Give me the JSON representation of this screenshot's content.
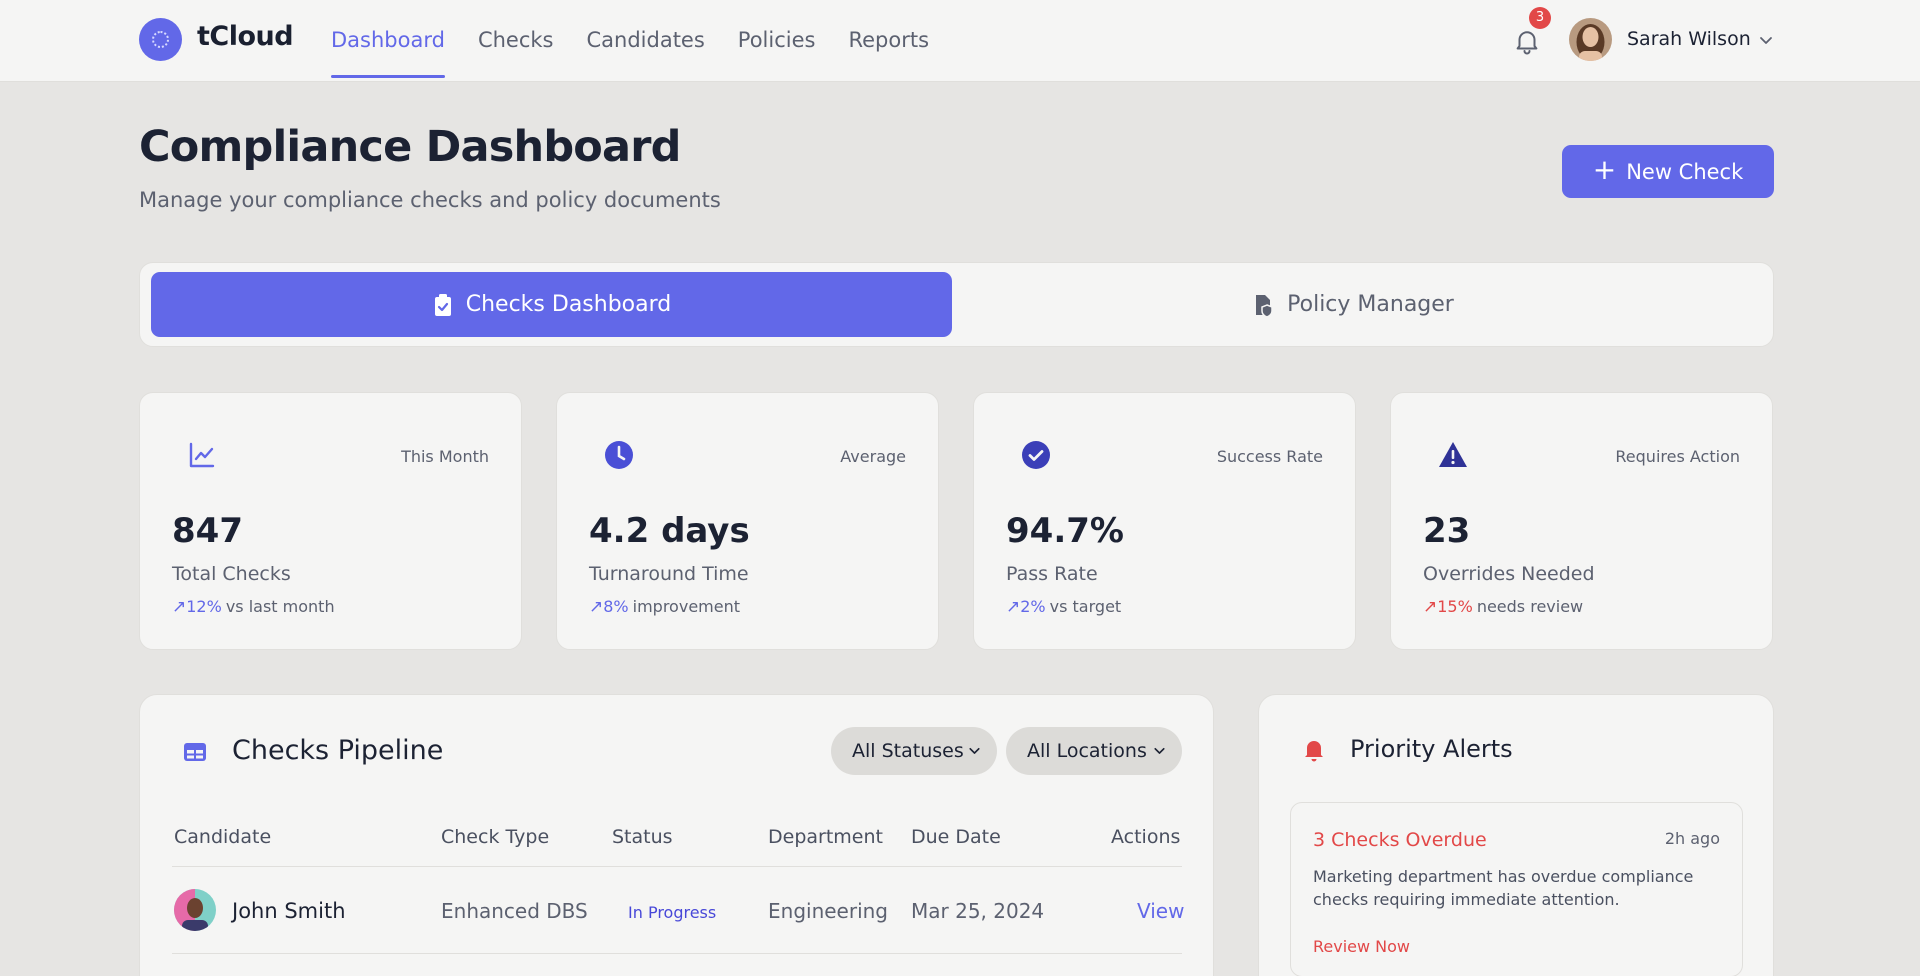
{
  "brand": {
    "name": "tCloud"
  },
  "nav": {
    "items": [
      {
        "label": "Dashboard",
        "active": true
      },
      {
        "label": "Checks"
      },
      {
        "label": "Candidates"
      },
      {
        "label": "Policies"
      },
      {
        "label": "Reports"
      }
    ]
  },
  "user": {
    "name": "Sarah Wilson",
    "notification_count": "3"
  },
  "header": {
    "title": "Compliance Dashboard",
    "subtitle": "Manage your compliance checks and policy documents",
    "new_check_label": "New Check"
  },
  "tabs": [
    {
      "label": "Checks Dashboard",
      "active": true,
      "icon": "clipboard-check-icon"
    },
    {
      "label": "Policy Manager",
      "icon": "file-shield-icon"
    }
  ],
  "stats": [
    {
      "tag": "This Month",
      "value": "847",
      "label": "Total Checks",
      "trend_pct": "12%",
      "trend_text": "vs last month",
      "icon": "chart-line-icon"
    },
    {
      "tag": "Average",
      "value": "4.2 days",
      "label": "Turnaround Time",
      "trend_pct": "8%",
      "trend_text": "improvement",
      "icon": "clock-icon"
    },
    {
      "tag": "Success Rate",
      "value": "94.7%",
      "label": "Pass Rate",
      "trend_pct": "2%",
      "trend_text": "vs target",
      "icon": "check-circle-icon"
    },
    {
      "tag": "Requires Action",
      "value": "23",
      "label": "Overrides Needed",
      "trend_pct": "15%",
      "trend_text": "needs review",
      "icon": "warning-icon"
    }
  ],
  "pipeline": {
    "title": "Checks Pipeline",
    "filters": {
      "status": "All Statuses",
      "location": "All Locations"
    },
    "columns": [
      "Candidate",
      "Check Type",
      "Status",
      "Department",
      "Due Date",
      "Actions"
    ],
    "rows": [
      {
        "candidate": "John Smith",
        "check_type": "Enhanced DBS",
        "status": "In Progress",
        "department": "Engineering",
        "due_date": "Mar 25, 2024",
        "action": "View"
      }
    ]
  },
  "alerts": {
    "title": "Priority Alerts",
    "items": [
      {
        "title": "3 Checks Overdue",
        "time": "2h ago",
        "body": "Marketing department has overdue compliance checks requiring immediate attention.",
        "link": "Review Now"
      }
    ]
  },
  "colors": {
    "accent": "#6268e8",
    "danger": "#e24848",
    "background": "#e6e5e3",
    "card": "#f5f5f4"
  }
}
